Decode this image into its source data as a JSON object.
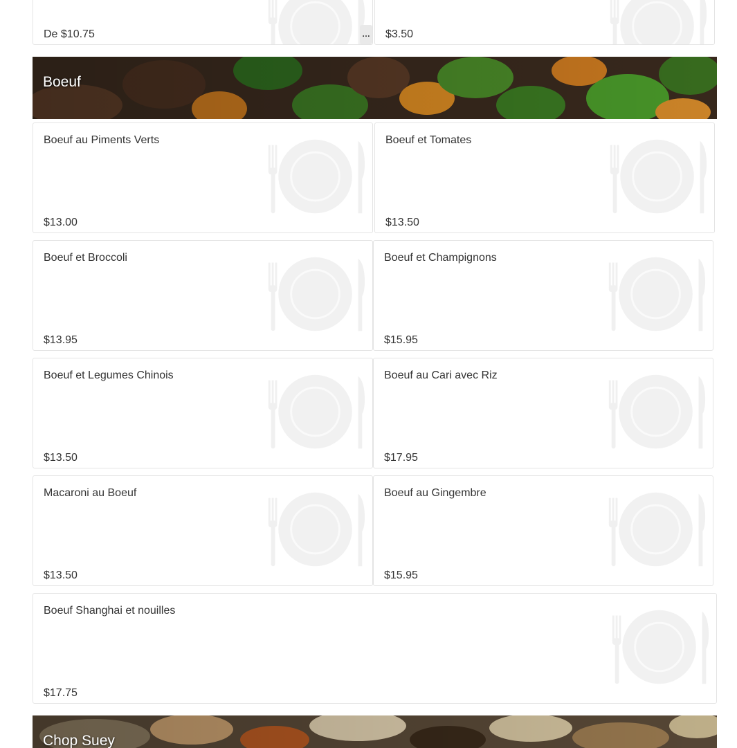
{
  "top_items": [
    {
      "price": "De $10.75",
      "more_label": "…"
    },
    {
      "price": "$3.50"
    }
  ],
  "sections": [
    {
      "title": "Boeuf",
      "items": [
        {
          "name": "Boeuf au Piments Verts",
          "price": "$13.00"
        },
        {
          "name": "Boeuf et Tomates",
          "price": "$13.50"
        },
        {
          "name": "Boeuf et Broccoli",
          "price": "$13.95"
        },
        {
          "name": "Boeuf et Champignons",
          "price": "$15.95"
        },
        {
          "name": "Boeuf et Legumes Chinois",
          "price": "$13.50"
        },
        {
          "name": "Boeuf au Cari avec Riz",
          "price": "$17.95"
        },
        {
          "name": "Macaroni au Boeuf",
          "price": "$13.50"
        },
        {
          "name": "Boeuf au Gingembre",
          "price": "$15.95"
        },
        {
          "name": "Boeuf Shanghai et nouilles",
          "price": "$17.75"
        }
      ]
    },
    {
      "title": "Chop Suey",
      "items": []
    }
  ],
  "icons": {
    "placeholder": "plate-fork-knife-icon"
  }
}
